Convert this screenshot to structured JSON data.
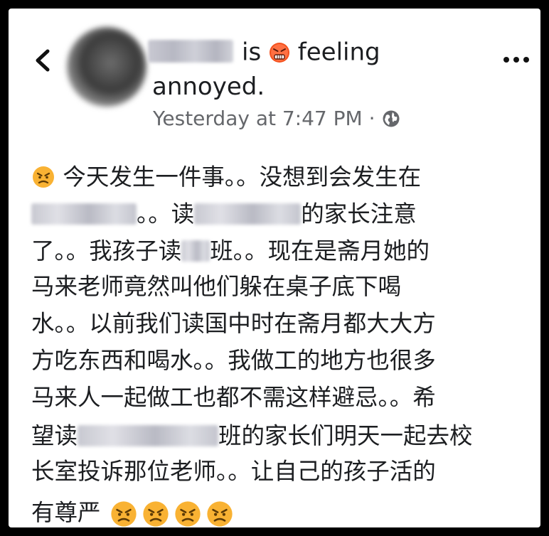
{
  "post": {
    "back_label": "Back",
    "header_is": "is",
    "header_feeling": "feeling",
    "header_line2": "annoyed.",
    "timestamp": "Yesterday at 7:47 PM",
    "separator": "·",
    "privacy_icon": "globe-icon",
    "more_icon": "more-options-icon",
    "feeling_icon": "angry-face-emoji"
  },
  "body": {
    "l1": "今天发生一件事。。没想到会发生在",
    "l2a": "。。读",
    "l2b": "的家长注意",
    "l3a": "了。。我孩子读",
    "l3b": "班。。现在是斋月她的",
    "l4": "马来老师竟然叫他们躲在桌子底下喝",
    "l5": "水。。以前我们读国中时在斋月都大大方",
    "l6": "方吃东西和喝水。。我做工的地方也很多",
    "l7": "马来人一起做工也都不需这样避忌。。希",
    "l8a": "望读",
    "l8b": "班的家长们明天一起去校",
    "l9": "长室投诉那位老师。。让自己的孩子活的",
    "l10": "有尊严"
  },
  "colors": {
    "text": "#1c1e21",
    "meta": "#65676b",
    "emoji_yellow": "#fbc02d"
  }
}
